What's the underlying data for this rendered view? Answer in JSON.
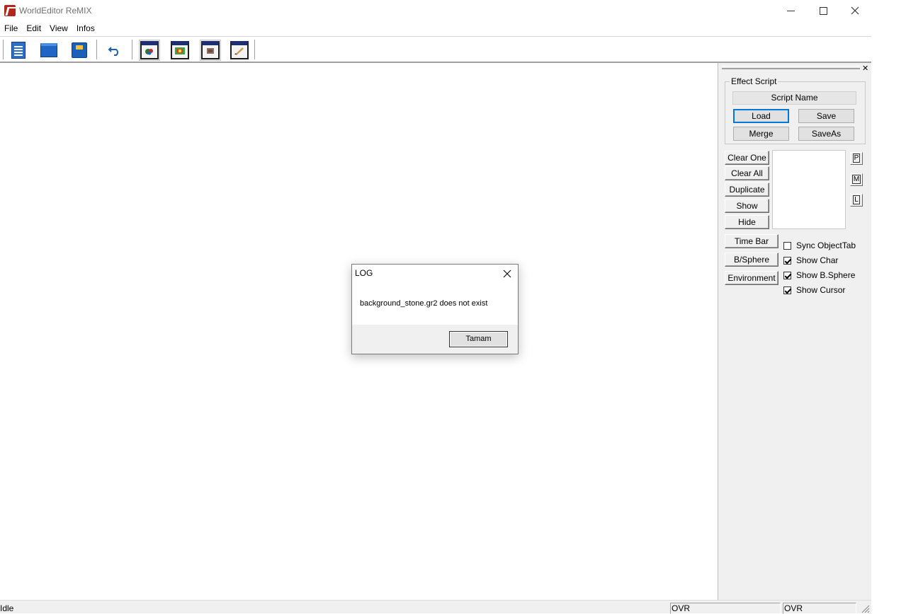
{
  "window": {
    "title": "WorldEditor ReMIX",
    "app_icon": "worldeditor-app-icon"
  },
  "menu": [
    "File",
    "Edit",
    "View",
    "Infos"
  ],
  "toolbar": {
    "buttons": [
      {
        "name": "new-document",
        "icon": "document-icon"
      },
      {
        "name": "open",
        "icon": "folder-icon"
      },
      {
        "name": "save",
        "icon": "save-icon"
      },
      {
        "name": "undo",
        "icon": "undo-icon"
      },
      {
        "name": "view-objects",
        "icon": "window-objects-icon"
      },
      {
        "name": "view-texture",
        "icon": "window-texture-icon"
      },
      {
        "name": "view-map",
        "icon": "window-map-icon"
      },
      {
        "name": "view-brush",
        "icon": "window-brush-icon"
      }
    ]
  },
  "panel": {
    "group_title": "Effect Script",
    "script_name": "Script Name",
    "buttons": {
      "load": "Load",
      "save": "Save",
      "merge": "Merge",
      "saveas": "SaveAs",
      "clear_one": "Clear One",
      "clear_all": "Clear All",
      "duplicate": "Duplicate",
      "show": "Show",
      "hide": "Hide",
      "time_bar": "Time Bar",
      "b_sphere": "B/Sphere",
      "environment": "Environment"
    },
    "side_buttons": [
      "P",
      "M",
      "L"
    ],
    "checkboxes": [
      {
        "label": "Sync ObjectTab",
        "checked": false
      },
      {
        "label": "Show Char",
        "checked": true
      },
      {
        "label": "Show B.Sphere",
        "checked": true
      },
      {
        "label": "Show Cursor",
        "checked": true
      }
    ]
  },
  "dialog": {
    "title": "LOG",
    "message": "background_stone.gr2 does not exist",
    "ok_label": "Tamam"
  },
  "status": {
    "text": "Idle",
    "pane1": "OVR",
    "pane2": "OVR"
  }
}
